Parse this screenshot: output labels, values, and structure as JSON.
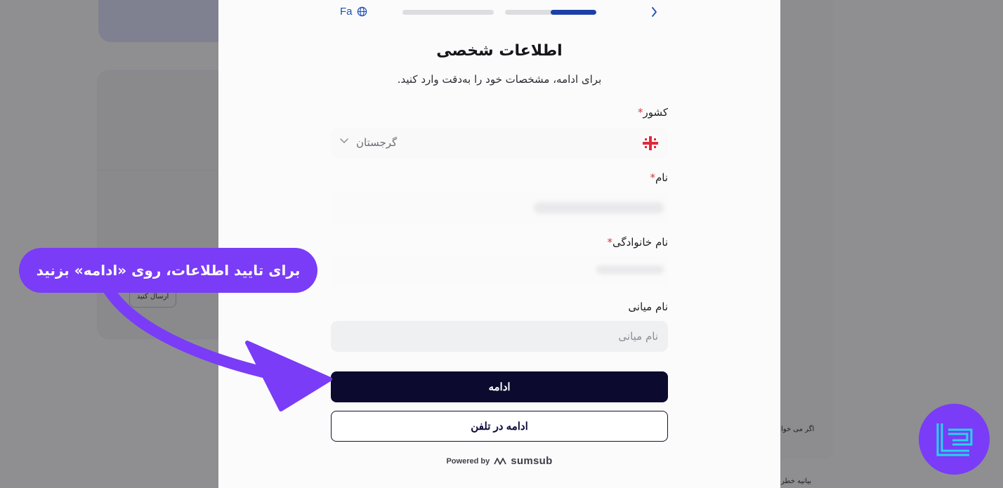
{
  "background": {
    "send_button_label": "ارسال کنید",
    "side_text": "اگر می خوا",
    "bottom_text": "بیانیه خطر"
  },
  "header": {
    "language_label": "Fa",
    "progress": [
      1.0,
      0.5
    ]
  },
  "form": {
    "title": "اطلاعات شخصی",
    "subtitle": "برای ادامه، مشخصات خود را به‌دقت وارد کنید.",
    "country_label": "کشور",
    "country_value": "گرجستان",
    "first_name_label": "نام",
    "last_name_label": "نام خانوادگی",
    "middle_name_label": "نام میانی",
    "middle_name_placeholder": "نام میانی",
    "required_mark": "*",
    "continue_label": "ادامه",
    "continue_on_phone_label": "ادامه در تلفن",
    "powered_by": "Powered by",
    "powered_brand": "sumsub"
  },
  "annotation": {
    "callout_text": "برای تایید اطلاعات، روی «ادامه» بزنید"
  },
  "colors": {
    "accent_purple": "#7a3cf7",
    "primary_button": "#0c0a2e",
    "progress_active": "#1c3fa8",
    "required": "#d7373f"
  }
}
